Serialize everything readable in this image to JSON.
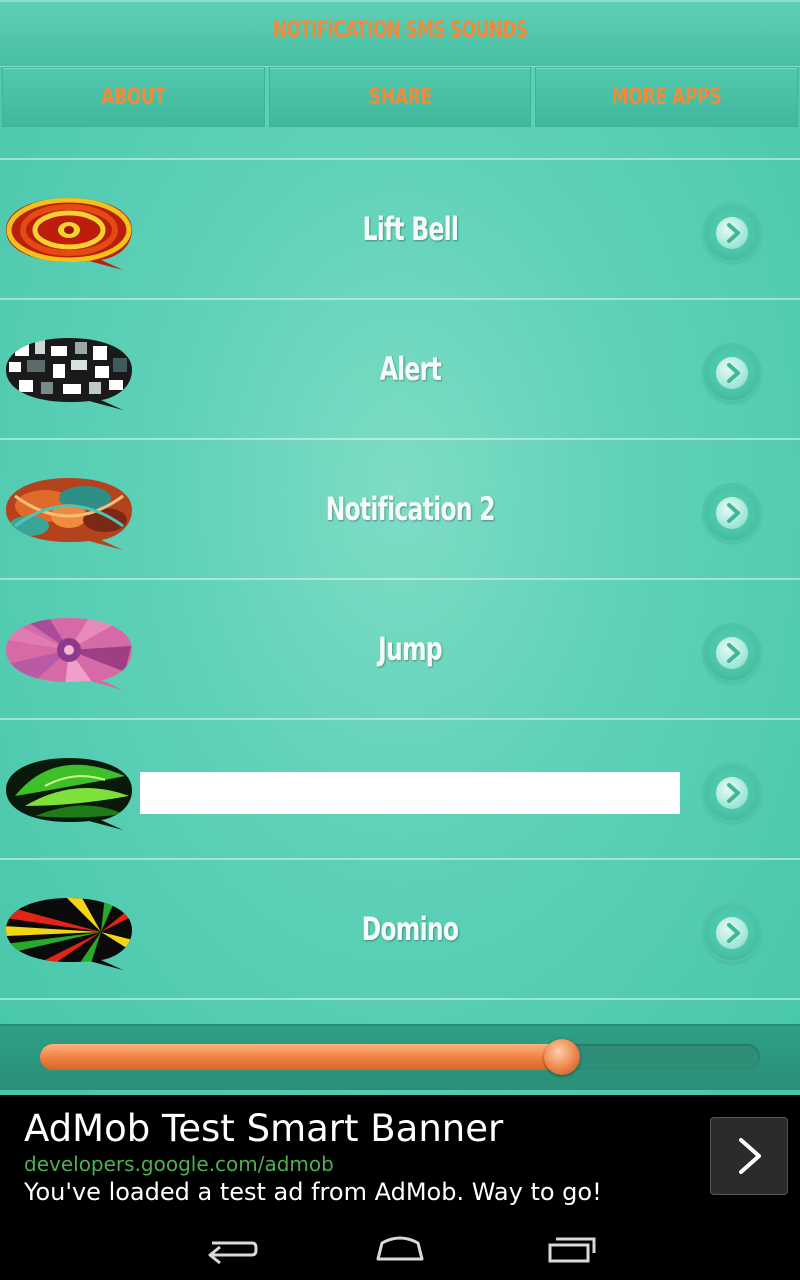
{
  "app": {
    "title": "NOTIFICATION SMS SOUNDS",
    "accent_color": "#f08a3c",
    "background_color": "#5fd2b8"
  },
  "tabs": [
    {
      "label": "ABOUT"
    },
    {
      "label": "SHARE"
    },
    {
      "label": "MORE APPS"
    }
  ],
  "sounds": [
    {
      "name": "Lift Bell",
      "thumbnail": "red-yellow-swirl-bubble"
    },
    {
      "name": "Alert",
      "thumbnail": "black-white-pixel-bubble"
    },
    {
      "name": "Notification 2",
      "thumbnail": "orange-teal-fractal-bubble"
    },
    {
      "name": "Jump",
      "thumbnail": "pink-kaleidoscope-bubble"
    },
    {
      "name": "",
      "thumbnail": "green-leaf-bubble"
    },
    {
      "name": "Domino",
      "thumbnail": "rasta-burst-bubble"
    }
  ],
  "player": {
    "progress_percent": 72.5,
    "fill_color": "#f07e3f"
  },
  "ad": {
    "title": "AdMob Test Smart Banner",
    "url": "developers.google.com/admob",
    "text": "You've loaded a test ad from AdMob. Way to go!",
    "button_icon": "chevron-right-icon"
  },
  "navbar": {
    "buttons": [
      "back-icon",
      "home-icon",
      "recent-apps-icon"
    ]
  }
}
